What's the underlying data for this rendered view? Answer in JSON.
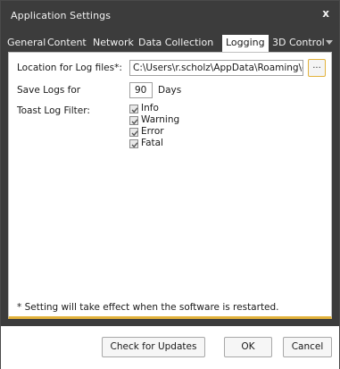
{
  "window": {
    "title": "Application Settings",
    "close_glyph": "x"
  },
  "tabs": [
    {
      "label": "General",
      "active": false
    },
    {
      "label": "Content",
      "active": false
    },
    {
      "label": "Network",
      "active": false
    },
    {
      "label": "Data Collection",
      "active": false
    },
    {
      "label": "Logging",
      "active": true
    },
    {
      "label": "3D Control",
      "active": false
    }
  ],
  "tab_overflow_icon": "chevron-down-icon",
  "logging": {
    "location_label": "Location for Log files*:",
    "location_value": "C:\\Users\\r.scholz\\AppData\\Roaming\\ecue",
    "browse_label": "...",
    "save_logs_label": "Save Logs for",
    "save_logs_value": "90",
    "save_logs_unit": "Days",
    "toast_filter_label": "Toast Log Filter:",
    "filters": [
      {
        "label": "Info",
        "checked": true
      },
      {
        "label": "Warning",
        "checked": true
      },
      {
        "label": "Error",
        "checked": true
      },
      {
        "label": "Fatal",
        "checked": true
      }
    ],
    "note": "* Setting will take effect when the software is restarted."
  },
  "footer": {
    "check_updates_label": "Check for Updates",
    "ok_label": "OK",
    "cancel_label": "Cancel"
  },
  "colors": {
    "chrome": "#3c3c3c",
    "accent": "#e2b23c",
    "panel": "#ffffff"
  }
}
